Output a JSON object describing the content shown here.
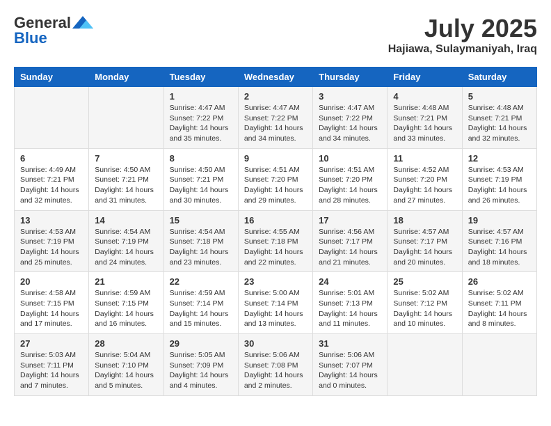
{
  "header": {
    "logo_general": "General",
    "logo_blue": "Blue",
    "month": "July 2025",
    "location": "Hajiawa, Sulaymaniyah, Iraq"
  },
  "weekdays": [
    "Sunday",
    "Monday",
    "Tuesday",
    "Wednesday",
    "Thursday",
    "Friday",
    "Saturday"
  ],
  "weeks": [
    [
      {
        "day": "",
        "content": ""
      },
      {
        "day": "",
        "content": ""
      },
      {
        "day": "1",
        "content": "Sunrise: 4:47 AM\nSunset: 7:22 PM\nDaylight: 14 hours\nand 35 minutes."
      },
      {
        "day": "2",
        "content": "Sunrise: 4:47 AM\nSunset: 7:22 PM\nDaylight: 14 hours\nand 34 minutes."
      },
      {
        "day": "3",
        "content": "Sunrise: 4:47 AM\nSunset: 7:22 PM\nDaylight: 14 hours\nand 34 minutes."
      },
      {
        "day": "4",
        "content": "Sunrise: 4:48 AM\nSunset: 7:21 PM\nDaylight: 14 hours\nand 33 minutes."
      },
      {
        "day": "5",
        "content": "Sunrise: 4:48 AM\nSunset: 7:21 PM\nDaylight: 14 hours\nand 32 minutes."
      }
    ],
    [
      {
        "day": "6",
        "content": "Sunrise: 4:49 AM\nSunset: 7:21 PM\nDaylight: 14 hours\nand 32 minutes."
      },
      {
        "day": "7",
        "content": "Sunrise: 4:50 AM\nSunset: 7:21 PM\nDaylight: 14 hours\nand 31 minutes."
      },
      {
        "day": "8",
        "content": "Sunrise: 4:50 AM\nSunset: 7:21 PM\nDaylight: 14 hours\nand 30 minutes."
      },
      {
        "day": "9",
        "content": "Sunrise: 4:51 AM\nSunset: 7:20 PM\nDaylight: 14 hours\nand 29 minutes."
      },
      {
        "day": "10",
        "content": "Sunrise: 4:51 AM\nSunset: 7:20 PM\nDaylight: 14 hours\nand 28 minutes."
      },
      {
        "day": "11",
        "content": "Sunrise: 4:52 AM\nSunset: 7:20 PM\nDaylight: 14 hours\nand 27 minutes."
      },
      {
        "day": "12",
        "content": "Sunrise: 4:53 AM\nSunset: 7:19 PM\nDaylight: 14 hours\nand 26 minutes."
      }
    ],
    [
      {
        "day": "13",
        "content": "Sunrise: 4:53 AM\nSunset: 7:19 PM\nDaylight: 14 hours\nand 25 minutes."
      },
      {
        "day": "14",
        "content": "Sunrise: 4:54 AM\nSunset: 7:19 PM\nDaylight: 14 hours\nand 24 minutes."
      },
      {
        "day": "15",
        "content": "Sunrise: 4:54 AM\nSunset: 7:18 PM\nDaylight: 14 hours\nand 23 minutes."
      },
      {
        "day": "16",
        "content": "Sunrise: 4:55 AM\nSunset: 7:18 PM\nDaylight: 14 hours\nand 22 minutes."
      },
      {
        "day": "17",
        "content": "Sunrise: 4:56 AM\nSunset: 7:17 PM\nDaylight: 14 hours\nand 21 minutes."
      },
      {
        "day": "18",
        "content": "Sunrise: 4:57 AM\nSunset: 7:17 PM\nDaylight: 14 hours\nand 20 minutes."
      },
      {
        "day": "19",
        "content": "Sunrise: 4:57 AM\nSunset: 7:16 PM\nDaylight: 14 hours\nand 18 minutes."
      }
    ],
    [
      {
        "day": "20",
        "content": "Sunrise: 4:58 AM\nSunset: 7:15 PM\nDaylight: 14 hours\nand 17 minutes."
      },
      {
        "day": "21",
        "content": "Sunrise: 4:59 AM\nSunset: 7:15 PM\nDaylight: 14 hours\nand 16 minutes."
      },
      {
        "day": "22",
        "content": "Sunrise: 4:59 AM\nSunset: 7:14 PM\nDaylight: 14 hours\nand 15 minutes."
      },
      {
        "day": "23",
        "content": "Sunrise: 5:00 AM\nSunset: 7:14 PM\nDaylight: 14 hours\nand 13 minutes."
      },
      {
        "day": "24",
        "content": "Sunrise: 5:01 AM\nSunset: 7:13 PM\nDaylight: 14 hours\nand 11 minutes."
      },
      {
        "day": "25",
        "content": "Sunrise: 5:02 AM\nSunset: 7:12 PM\nDaylight: 14 hours\nand 10 minutes."
      },
      {
        "day": "26",
        "content": "Sunrise: 5:02 AM\nSunset: 7:11 PM\nDaylight: 14 hours\nand 8 minutes."
      }
    ],
    [
      {
        "day": "27",
        "content": "Sunrise: 5:03 AM\nSunset: 7:11 PM\nDaylight: 14 hours\nand 7 minutes."
      },
      {
        "day": "28",
        "content": "Sunrise: 5:04 AM\nSunset: 7:10 PM\nDaylight: 14 hours\nand 5 minutes."
      },
      {
        "day": "29",
        "content": "Sunrise: 5:05 AM\nSunset: 7:09 PM\nDaylight: 14 hours\nand 4 minutes."
      },
      {
        "day": "30",
        "content": "Sunrise: 5:06 AM\nSunset: 7:08 PM\nDaylight: 14 hours\nand 2 minutes."
      },
      {
        "day": "31",
        "content": "Sunrise: 5:06 AM\nSunset: 7:07 PM\nDaylight: 14 hours\nand 0 minutes."
      },
      {
        "day": "",
        "content": ""
      },
      {
        "day": "",
        "content": ""
      }
    ]
  ]
}
